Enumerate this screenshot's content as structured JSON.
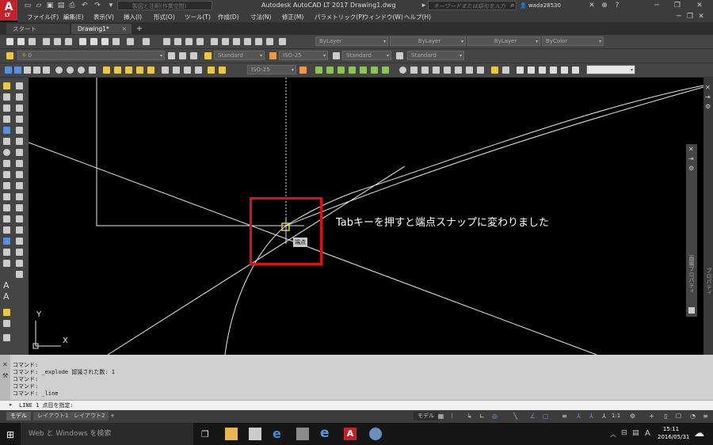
{
  "app": {
    "logo_letter": "A",
    "logo_sub": "LT",
    "title": "Autodesk AutoCAD LT 2017    Drawing1.dwg",
    "workspace": "製図と注釈(作業空間)",
    "search_placeholder": "キーワードまたは語句を入力",
    "user": "wada28530"
  },
  "menu": [
    "ファイル(F)",
    "編集(E)",
    "表示(V)",
    "挿入(I)",
    "形式(O)",
    "ツール(T)",
    "作成(D)",
    "寸法(N)",
    "修正(M)",
    "パラメトリック(P)",
    "ウィンドウ(W)",
    "ヘルプ(H)"
  ],
  "tabs": {
    "start": "スタート",
    "drawing": "Drawing1*",
    "add": "+"
  },
  "toolbar": {
    "layer_color": "ByLayer",
    "linetype": "ByLayer",
    "lineweight": "ByLayer",
    "plotstyle": "ByColor",
    "layer": "0",
    "text_style": "Standard",
    "dim_style": "ISO-25",
    "table_style": "Standard",
    "mleader_style": "Standard",
    "dim_style2": "ISO-25"
  },
  "canvas": {
    "snap_tooltip": "端点",
    "ucs_x": "X",
    "ucs_y": "Y",
    "annotation": "Tabキーを押すと端点スナップに変わりました",
    "annotation_color": "#e01010"
  },
  "properties_panel": {
    "label1": "プロパティ",
    "label2": "画層プロパティ"
  },
  "command": {
    "history": [
      "コマンド:",
      "コマンド: _explode 認識された数: 1",
      "コマンド:",
      "コマンド:",
      "コマンド: _line"
    ],
    "prompt": "LINE 1 点目を指定:"
  },
  "layout_tabs": [
    "モデル",
    "レイアウト1",
    "レイアウト2",
    "+"
  ],
  "status": {
    "model": "モデル",
    "scale": "1:1"
  },
  "taskbar": {
    "search": "Web と Windows を検索",
    "time": "15:11",
    "date": "2016/05/31",
    "ime": "A"
  }
}
